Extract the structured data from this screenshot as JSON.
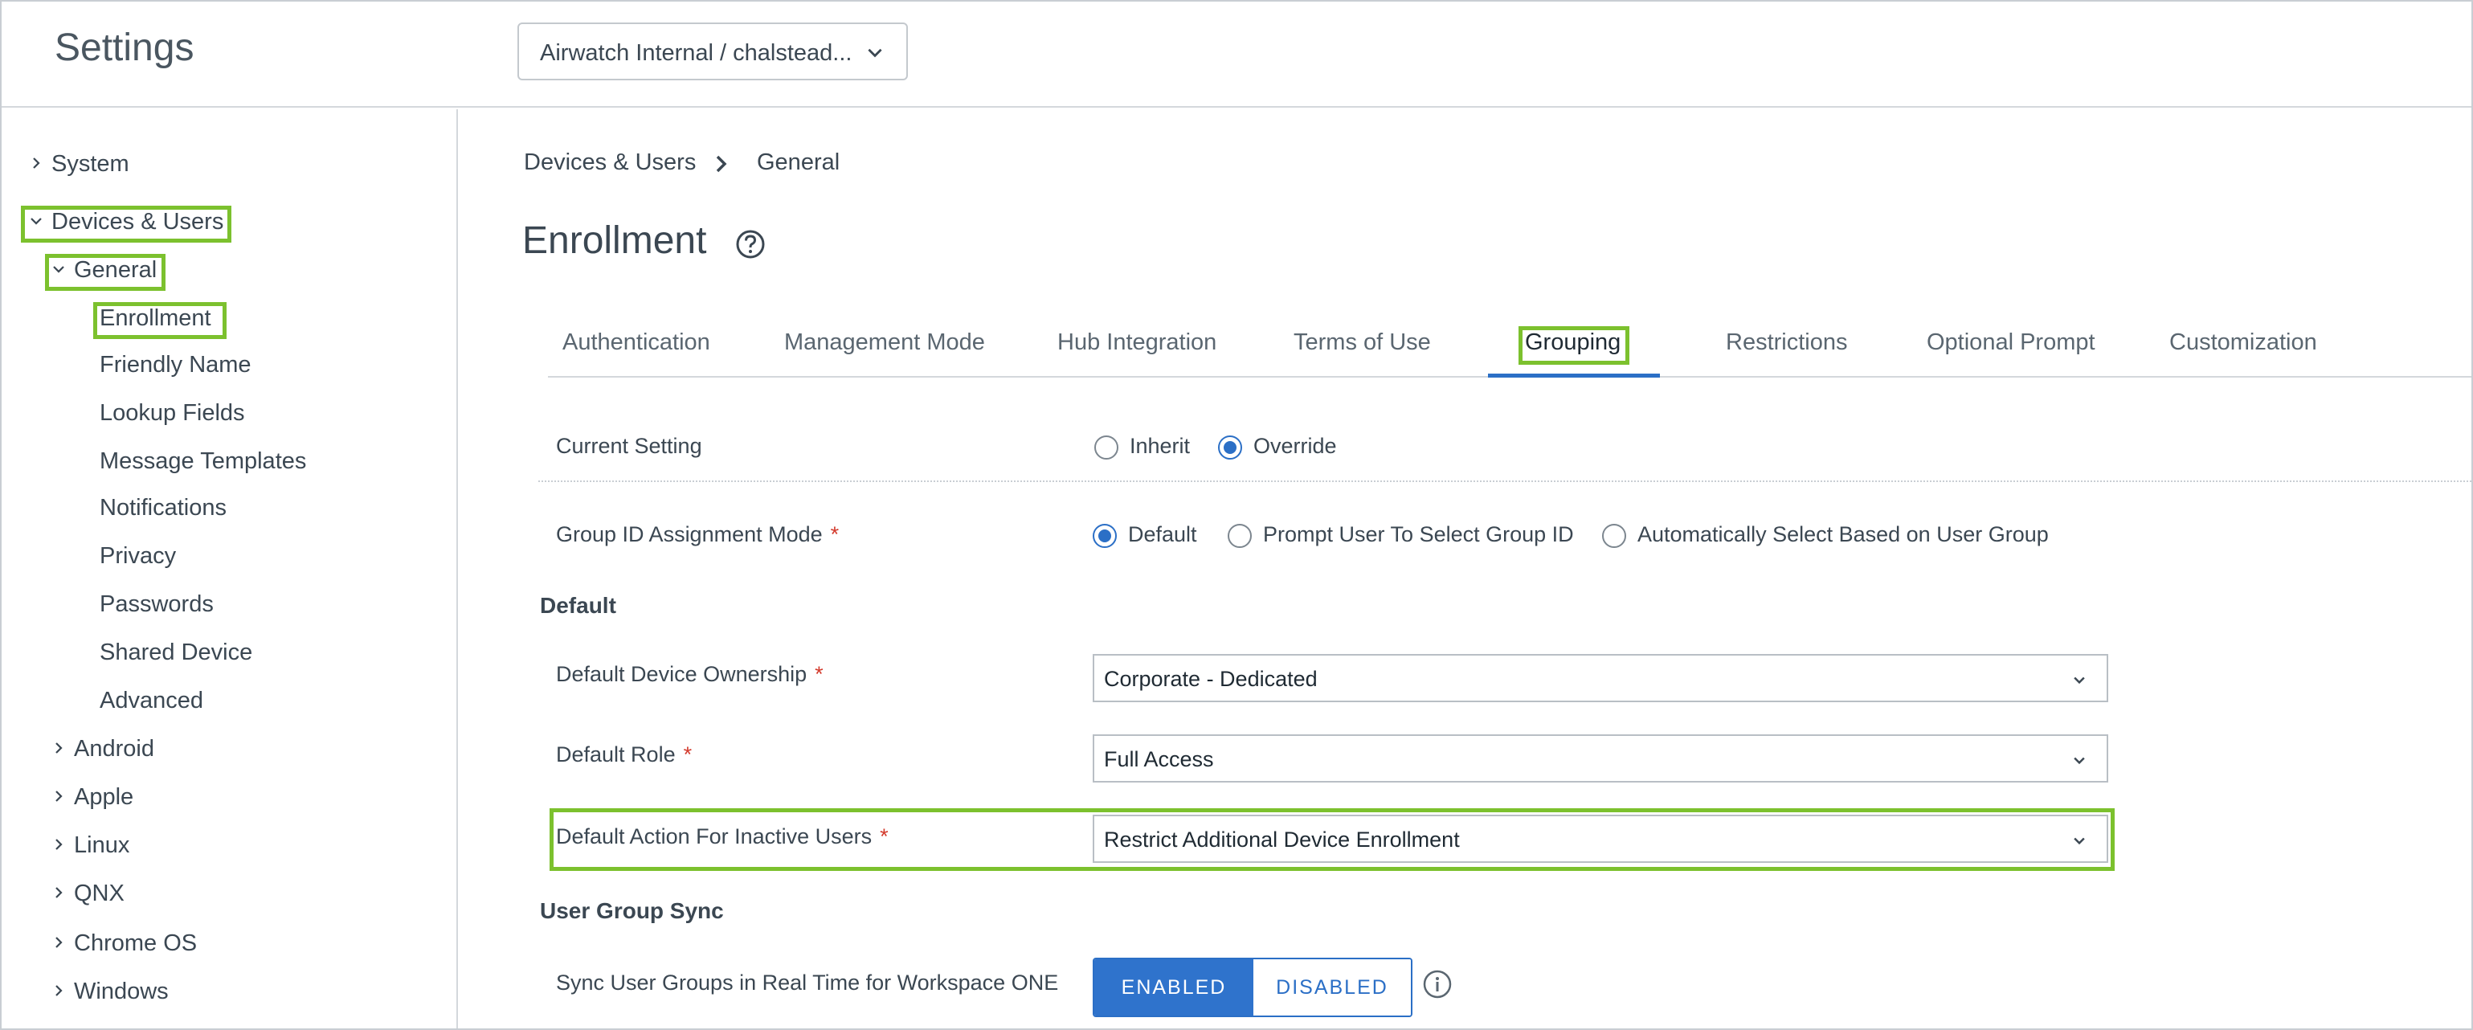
{
  "header": {
    "title": "Settings",
    "org_selector": "Airwatch Internal / chalstead..."
  },
  "sidebar": {
    "items": [
      {
        "label": "System"
      },
      {
        "label": "Devices & Users"
      },
      {
        "label": "General"
      },
      {
        "label": "Enrollment"
      },
      {
        "label": "Friendly Name"
      },
      {
        "label": "Lookup Fields"
      },
      {
        "label": "Message Templates"
      },
      {
        "label": "Notifications"
      },
      {
        "label": "Privacy"
      },
      {
        "label": "Passwords"
      },
      {
        "label": "Shared Device"
      },
      {
        "label": "Advanced"
      },
      {
        "label": "Android"
      },
      {
        "label": "Apple"
      },
      {
        "label": "Linux"
      },
      {
        "label": "QNX"
      },
      {
        "label": "Chrome OS"
      },
      {
        "label": "Windows"
      }
    ]
  },
  "breadcrumb": {
    "items": [
      "Devices & Users",
      "General"
    ]
  },
  "page": {
    "title": "Enrollment"
  },
  "tabs": [
    {
      "label": "Authentication"
    },
    {
      "label": "Management Mode"
    },
    {
      "label": "Hub Integration"
    },
    {
      "label": "Terms of Use"
    },
    {
      "label": "Grouping"
    },
    {
      "label": "Restrictions"
    },
    {
      "label": "Optional Prompt"
    },
    {
      "label": "Customization"
    }
  ],
  "active_tab": "Grouping",
  "form": {
    "current_setting": {
      "label": "Current Setting",
      "options": [
        "Inherit",
        "Override"
      ],
      "selected": "Override"
    },
    "group_id_mode": {
      "label": "Group ID Assignment Mode",
      "required": "*",
      "options": [
        "Default",
        "Prompt User To Select Group ID",
        "Automatically Select Based on User Group"
      ],
      "selected": "Default"
    },
    "default_section": "Default",
    "device_ownership": {
      "label": "Default Device Ownership",
      "required": "*",
      "value": "Corporate - Dedicated"
    },
    "default_role": {
      "label": "Default Role",
      "required": "*",
      "value": "Full Access"
    },
    "inactive_action": {
      "label": "Default Action For Inactive Users",
      "required": "*",
      "value": "Restrict Additional Device Enrollment"
    },
    "user_group_sync_section": "User Group Sync",
    "sync_realtime": {
      "label": "Sync User Groups in Real Time for Workspace ONE",
      "enabled": "ENABLED",
      "disabled": "DISABLED",
      "state": "enabled"
    }
  },
  "colors": {
    "highlight": "#7cc12e",
    "accent": "#2b6fc6",
    "required": "#d33a2c"
  }
}
